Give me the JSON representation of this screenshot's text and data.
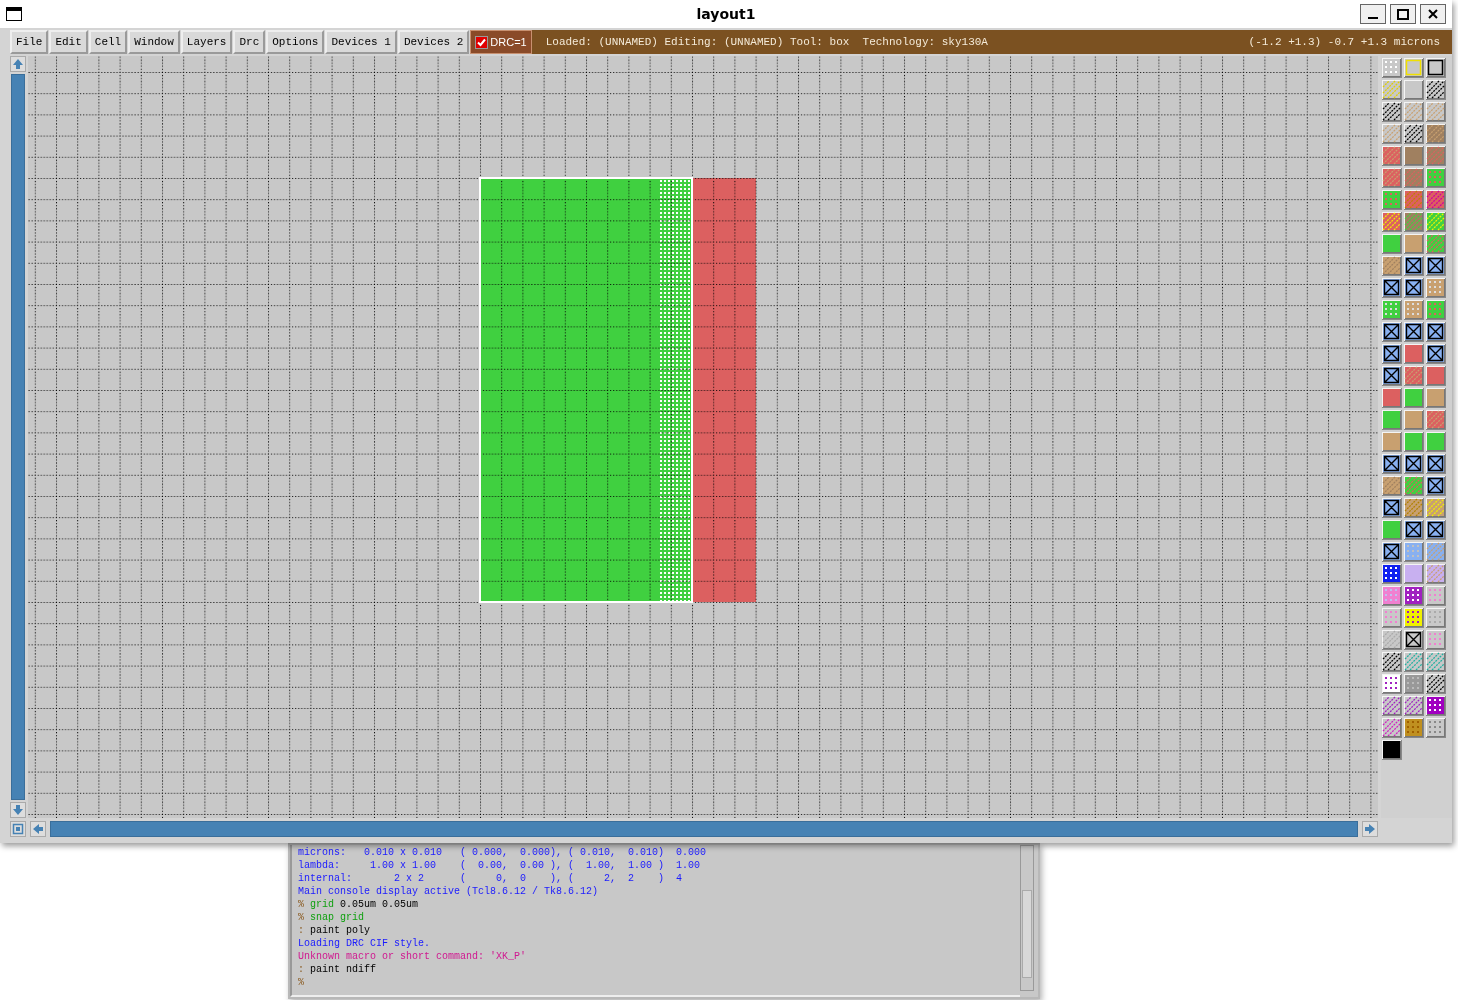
{
  "window": {
    "title": "layout1"
  },
  "menu": [
    {
      "label": "File"
    },
    {
      "label": "Edit"
    },
    {
      "label": "Cell"
    },
    {
      "label": "Window"
    },
    {
      "label": "Layers"
    },
    {
      "label": "Drc"
    },
    {
      "label": "Options"
    },
    {
      "label": "Devices 1"
    },
    {
      "label": "Devices 2"
    }
  ],
  "drc_toggle": {
    "label": "DRC=1",
    "checked": true
  },
  "status": {
    "info": "Loaded: (UNNAMED) Editing: (UNNAMED) Tool: box  Technology: sky130A",
    "coordinates": "(-1.2 +1.3) -0.7 +1.3 microns"
  },
  "console": {
    "lines": [
      {
        "parts": [
          {
            "kind": "info",
            "text": "microns:   0.010 x 0.010   ( 0.000,  0.000), ( 0.010,  0.010)  0.000"
          }
        ]
      },
      {
        "parts": [
          {
            "kind": "info",
            "text": "lambda:     1.00 x 1.00    (  0.00,  0.00 ), (  1.00,  1.00 )  1.00"
          }
        ]
      },
      {
        "parts": [
          {
            "kind": "info",
            "text": "internal:       2 x 2      (     0,  0    ), (     2,  2    )  4"
          }
        ]
      },
      {
        "parts": [
          {
            "kind": "info",
            "text": "Main console display active (Tcl8.6.12 / Tk8.6.12)"
          }
        ]
      },
      {
        "parts": [
          {
            "kind": "prompt",
            "text": "%"
          },
          {
            "kind": "command",
            "text": "grid"
          },
          {
            "kind": "plain",
            "text": "0.05um 0.05um"
          }
        ]
      },
      {
        "parts": [
          {
            "kind": "prompt",
            "text": "%"
          },
          {
            "kind": "command",
            "text": "snap grid"
          }
        ]
      },
      {
        "parts": [
          {
            "kind": "prompt",
            "text": ":"
          },
          {
            "kind": "plain",
            "text": "paint poly"
          }
        ]
      },
      {
        "parts": [
          {
            "kind": "info",
            "text": "Loading DRC CIF style."
          }
        ]
      },
      {
        "parts": [
          {
            "kind": "error",
            "text": "Unknown macro or short command: 'XK_P'"
          }
        ]
      },
      {
        "parts": [
          {
            "kind": "prompt",
            "text": ":"
          },
          {
            "kind": "plain",
            "text": "paint ndiff"
          }
        ]
      },
      {
        "parts": [
          {
            "kind": "prompt",
            "text": "%"
          }
        ]
      }
    ]
  }
}
